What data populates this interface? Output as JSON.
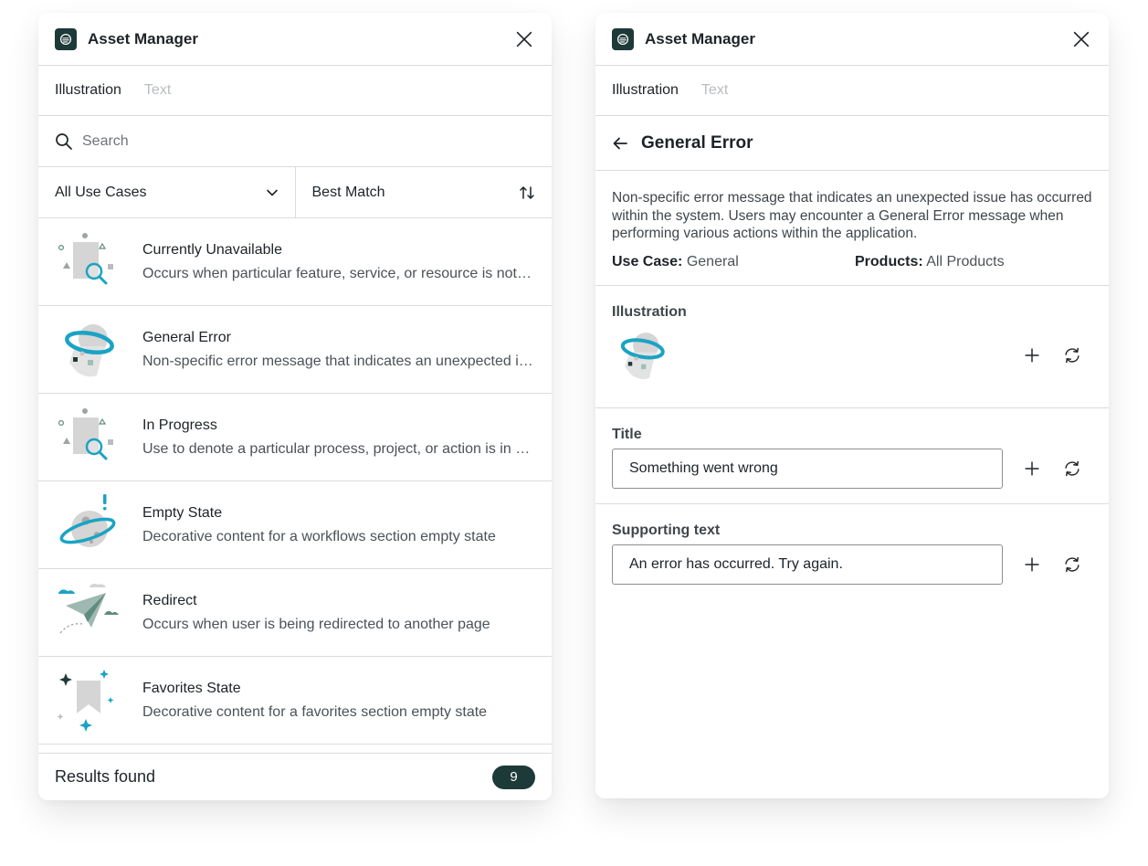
{
  "app": {
    "title": "Asset Manager"
  },
  "tabs": [
    {
      "label": "Illustration",
      "active": true
    },
    {
      "label": "Text",
      "active": false
    }
  ],
  "search": {
    "placeholder": "Search",
    "value": ""
  },
  "filters": {
    "use_case": "All Use Cases",
    "sort": "Best Match"
  },
  "list": {
    "items": [
      {
        "title": "Currently Unavailable",
        "description": "Occurs when particular feature, service, or resource is not available",
        "icon": "magnifier-illustration"
      },
      {
        "title": "General Error",
        "description": "Non-specific error message that indicates an unexpected issue has occurred",
        "icon": "ufo-illustration"
      },
      {
        "title": "In Progress",
        "description": "Use to denote a particular process, project, or action is in progress",
        "icon": "magnifier-illustration"
      },
      {
        "title": "Empty State",
        "description": "Decorative content for a workflows section empty state",
        "icon": "planet-illustration"
      },
      {
        "title": "Redirect",
        "description": "Occurs when user is being redirected to another page",
        "icon": "paper-plane-illustration"
      },
      {
        "title": "Favorites State",
        "description": "Decorative content for a favorites section empty state",
        "icon": "bookmark-illustration"
      }
    ]
  },
  "footer": {
    "label": "Results found",
    "count": "9"
  },
  "detail": {
    "title": "General Error",
    "description": "Non-specific error message that indicates an unexpected issue has occurred within the system. Users may encounter a General Error message when performing various actions within the application.",
    "use_case_label": "Use Case:",
    "use_case_value": "General",
    "products_label": "Products:",
    "products_value": "All Products",
    "illustration_label": "Illustration",
    "title_label": "Title",
    "title_value": "Something went wrong",
    "supporting_label": "Supporting text",
    "supporting_value": "An error has occurred. Try again."
  },
  "colors": {
    "accent": "#1aa3c4",
    "brand_dark": "#1e3a38",
    "border": "#d9dcde",
    "illustration_gray": "#d5d5d5",
    "illustration_green": "#5e8c7f"
  }
}
